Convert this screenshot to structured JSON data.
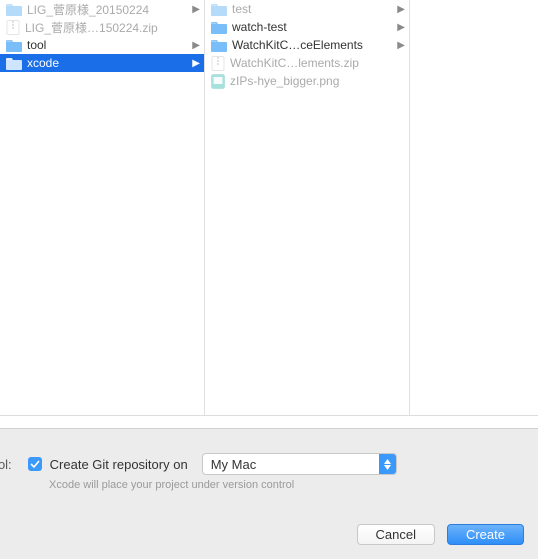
{
  "column1": [
    {
      "name": "LIG_菅原様_20150224",
      "type": "folder",
      "dim": true,
      "chevron": true
    },
    {
      "name": "LIG_菅原様…150224.zip",
      "type": "zip",
      "dim": true,
      "chevron": false
    },
    {
      "name": "tool",
      "type": "folder",
      "dim": false,
      "chevron": true
    },
    {
      "name": "xcode",
      "type": "folder",
      "dim": false,
      "chevron": true,
      "selected": true
    }
  ],
  "column2": [
    {
      "name": "test",
      "type": "folder",
      "dim": true,
      "chevron": true
    },
    {
      "name": "watch-test",
      "type": "folder",
      "dim": false,
      "chevron": true
    },
    {
      "name": "WatchKitC…ceElements",
      "type": "folder",
      "dim": false,
      "chevron": true
    },
    {
      "name": "WatchKitC…lements.zip",
      "type": "zip",
      "dim": true,
      "chevron": false
    },
    {
      "name": "zIPs-hye_bigger.png",
      "type": "png",
      "dim": true,
      "chevron": false
    }
  ],
  "controlLabel": "trol:",
  "checkbox": {
    "checked": true,
    "label": "Create Git repository on"
  },
  "dropdown": {
    "value": "My Mac"
  },
  "helpText": "Xcode will place your project under version control",
  "buttons": {
    "cancel": "Cancel",
    "create": "Create"
  }
}
